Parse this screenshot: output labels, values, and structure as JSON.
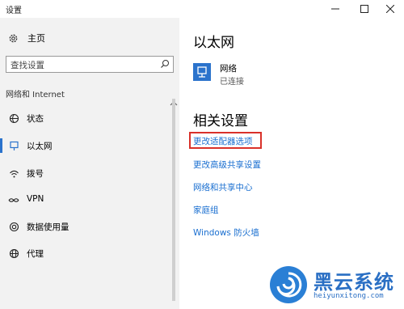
{
  "window": {
    "title": "设置",
    "min_label": "minimize",
    "max_label": "maximize",
    "close_label": "close"
  },
  "sidebar": {
    "home_label": "主页",
    "search_placeholder": "查找设置",
    "section_label": "网络和 Internet",
    "items": [
      {
        "label": "状态",
        "icon": "globe-status-icon",
        "selected": false
      },
      {
        "label": "以太网",
        "icon": "ethernet-icon",
        "selected": true
      },
      {
        "label": "拨号",
        "icon": "dialup-icon",
        "selected": false
      },
      {
        "label": "VPN",
        "icon": "vpn-icon",
        "selected": false
      },
      {
        "label": "数据使用量",
        "icon": "data-usage-icon",
        "selected": false
      },
      {
        "label": "代理",
        "icon": "proxy-globe-icon",
        "selected": false
      }
    ]
  },
  "main": {
    "title": "以太网",
    "network": {
      "name": "网络",
      "status": "已连接"
    },
    "related_title": "相关设置",
    "links": [
      "更改适配器选项",
      "更改高级共享设置",
      "网络和共享中心",
      "家庭组",
      "Windows 防火墙"
    ]
  },
  "colors": {
    "accent": "#2b73cc",
    "link": "#1a6fd0",
    "highlight": "#d9312a",
    "sidebar_bg": "#f2f2f2"
  },
  "watermark": {
    "title": "黑云系统",
    "url": "heiyunxitong.com"
  }
}
